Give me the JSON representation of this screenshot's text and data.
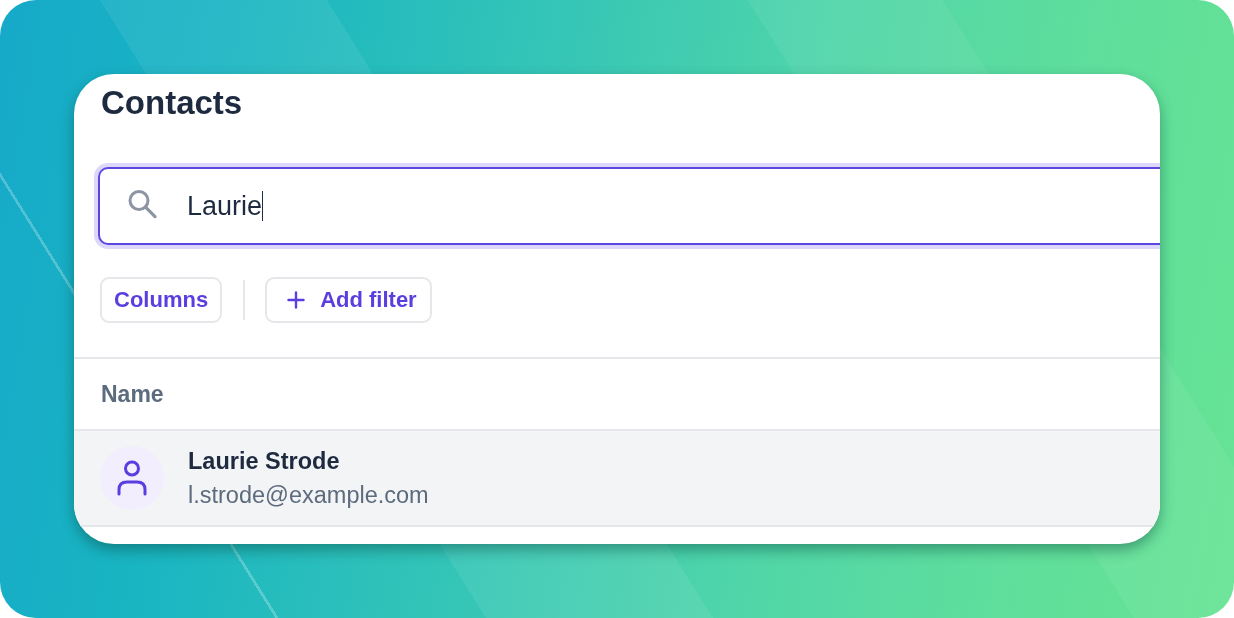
{
  "title": "Contacts",
  "search": {
    "value": "Laurie",
    "focused": true
  },
  "toolbar": [
    {
      "kind": "plain",
      "label": "Columns"
    },
    {
      "kind": "add",
      "label": "Add filter"
    }
  ],
  "table": {
    "columns": [
      {
        "label": "Name"
      }
    ],
    "rows": [
      {
        "name": "Laurie Strode",
        "email": "l.strode@example.com",
        "selected": true
      }
    ]
  }
}
